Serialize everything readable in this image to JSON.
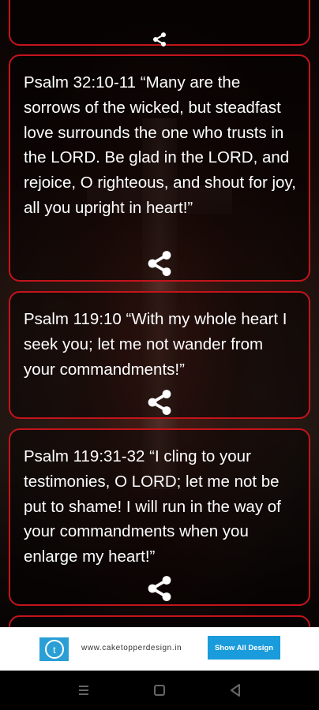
{
  "verses": [
    {
      "text": "Psalm 32:10-11 “Many are the sorrows of the wicked, but steadfast love surrounds the one who trusts in the LORD. Be glad in the LORD, and rejoice, O righteous, and shout for joy, all you upright in heart!”"
    },
    {
      "text": "Psalm 119:10 “With my whole heart I seek you; let me not wander from your commandments!”"
    },
    {
      "text": "Psalm 119:31-32 “I cling to your testimonies, O LORD; let me not be put to shame! I will run in the way of your commandments when you enlarge my heart!”"
    }
  ],
  "icons": {
    "share": "share-icon",
    "nav_menu": "menu-icon",
    "nav_home": "home-square-icon",
    "nav_back": "back-triangle-icon",
    "ad_logo": "cake-topper-logo-icon"
  },
  "ad": {
    "url_text": "www.caketopperdesign.in",
    "button_label": "Show All Design"
  },
  "colors": {
    "card_border": "#c4141c",
    "ad_button": "#1a9bdb",
    "text": "#ffffff"
  }
}
